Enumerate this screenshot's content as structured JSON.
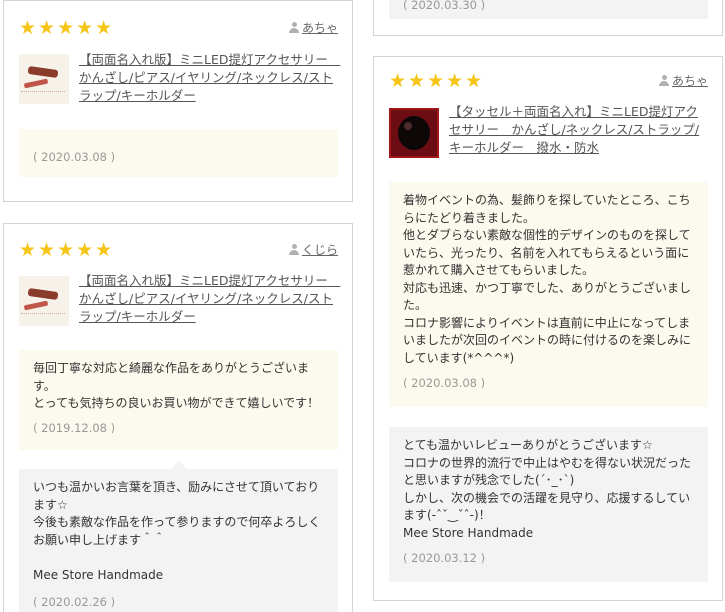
{
  "left_column": {
    "card1": {
      "stars": "★★★★★",
      "author": "あちゃ",
      "product_title": "【両面名入れ版】ミニLED提灯アクセサリー　かんざし/ピアス/イヤリング/ネックレス/ストラップ/キーホルダー",
      "review_date": "( 2020.03.08 )"
    },
    "card2": {
      "stars": "★★★★★",
      "author": "くじら",
      "product_title": "【両面名入れ版】ミニLED提灯アクセサリー　かんざし/ピアス/イヤリング/ネックレス/ストラップ/キーホルダー",
      "review_text": "毎回丁寧な対応と綺麗な作品をありがとうございます。\nとっても気持ちの良いお買い物ができて嬉しいです！",
      "review_date": "( 2019.12.08 )",
      "reply_text": "いつも温かいお言葉を頂き、励みにさせて頂いております☆\n今後も素敵な作品を作って参りますので何卒よろしくお願い申し上げます＾＾\n\nMee Store Handmade",
      "reply_date": "( 2020.02.26 )"
    }
  },
  "right_column": {
    "top_partial_date": "( 2020.03.30 )",
    "card1": {
      "stars": "★★★★★",
      "author": "あちゃ",
      "product_title": "【タッセル＋両面名入れ】ミニLED提灯アクセサリー　かんざし/ネックレス/ストラップ/キーホルダー　撥水・防水",
      "review_text": "着物イベントの為、髪飾りを探していたところ、こちらにたどり着きました。\n他とダブらない素敵な個性的デザインのものを探していたら、光ったり、名前を入れてもらえるという面に惹かれて購入させてもらいました。\n対応も迅速、かつ丁寧でした、ありがとうございました。\nコロナ影響によりイベントは直前に中止になってしまいましたが次回のイベントの時に付けるのを楽しみにしています(*^^^*)",
      "review_date": "( 2020.03.08 )",
      "reply_text": "とても温かいレビューありがとうございます☆\nコロナの世界的流行で中止はやむを得ない状況だったと思いますが残念でした(´･_･`)\nしかし、次の機会での活躍を見守り、応援するしています(-ˆˇ‿ˇˆ-)！\nMee Store Handmade",
      "reply_date": "( 2020.03.12 )"
    }
  },
  "colors": {
    "star": "#f5c518",
    "review_bg": "#fcf9ee",
    "reply_bg": "#f3f3f3",
    "border": "#d4d4d4"
  }
}
